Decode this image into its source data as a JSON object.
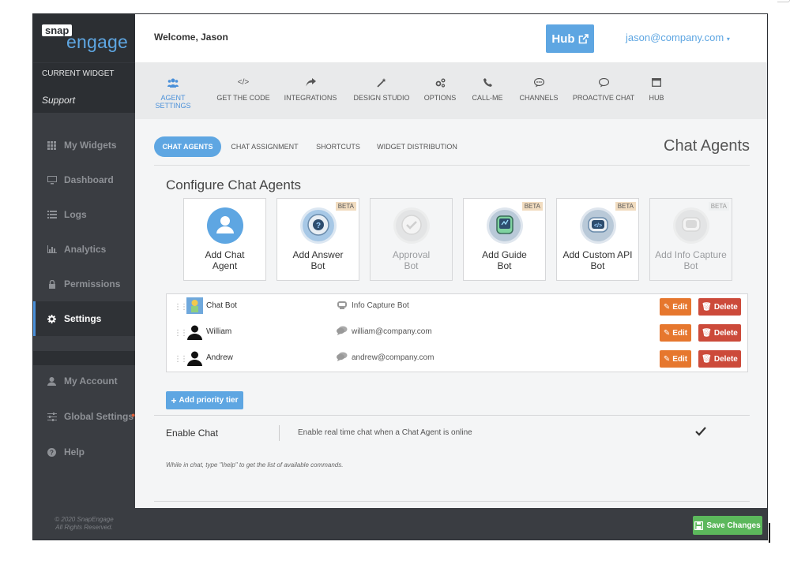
{
  "logo": {
    "top": "snap",
    "bottom": "engage"
  },
  "current_widget": {
    "label": "CURRENT WIDGET",
    "value": "Support"
  },
  "sidebar": {
    "items": [
      {
        "label": "My Widgets",
        "icon": "grid-icon"
      },
      {
        "label": "Dashboard",
        "icon": "monitor-icon"
      },
      {
        "label": "Logs",
        "icon": "list-icon"
      },
      {
        "label": "Analytics",
        "icon": "bar-chart-icon"
      },
      {
        "label": "Permissions",
        "icon": "lock-icon"
      },
      {
        "label": "Settings",
        "icon": "gear-icon",
        "active": true
      },
      {
        "label": "My Account",
        "icon": "user-icon"
      },
      {
        "label": "Global Settings",
        "icon": "sliders-icon"
      },
      {
        "label": "Help",
        "icon": "help-icon"
      }
    ],
    "copyright_line1": "© 2020 SnapEngage",
    "copyright_line2": "All Rights Reserved."
  },
  "header": {
    "welcome": "Welcome, Jason",
    "hub_label": "Hub",
    "user_email": "jason@company.com"
  },
  "tabs": [
    {
      "label": "AGENT SETTINGS",
      "icon": "users-icon",
      "active": true
    },
    {
      "label": "GET THE CODE",
      "icon": "code-icon"
    },
    {
      "label": "INTEGRATIONS",
      "icon": "share-arrow-icon"
    },
    {
      "label": "DESIGN STUDIO",
      "icon": "magic-wand-icon"
    },
    {
      "label": "OPTIONS",
      "icon": "cogs-icon"
    },
    {
      "label": "CALL-ME",
      "icon": "phone-icon"
    },
    {
      "label": "CHANNELS",
      "icon": "chat-bubble-icon"
    },
    {
      "label": "PROACTIVE CHAT",
      "icon": "speech-bubble-icon"
    },
    {
      "label": "HUB",
      "icon": "window-icon"
    }
  ],
  "subtabs": [
    {
      "label": "CHAT AGENTS",
      "active": true
    },
    {
      "label": "CHAT ASSIGNMENT"
    },
    {
      "label": "SHORTCUTS"
    },
    {
      "label": "WIDGET DISTRIBUTION"
    }
  ],
  "page_title": "Chat Agents",
  "config_title": "Configure Chat Agents",
  "cards": [
    {
      "label1": "Add Chat",
      "label2": "Agent",
      "beta": "",
      "disabled": false
    },
    {
      "label1": "Add Answer",
      "label2": "Bot",
      "beta": "BETA",
      "disabled": false
    },
    {
      "label1": "Approval",
      "label2": "Bot",
      "beta": "",
      "disabled": true
    },
    {
      "label1": "Add Guide",
      "label2": "Bot",
      "beta": "BETA",
      "disabled": false
    },
    {
      "label1": "Add Custom API",
      "label2": "Bot",
      "beta": "BETA",
      "disabled": false
    },
    {
      "label1": "Add Info Capture",
      "label2": "Bot",
      "beta": "BETA",
      "disabled": true
    }
  ],
  "agents": [
    {
      "name": "Chat Bot",
      "detail": "Info Capture Bot",
      "edit": "Edit",
      "delete": "Delete"
    },
    {
      "name": "William",
      "detail": "william@company.com",
      "edit": "Edit",
      "delete": "Delete"
    },
    {
      "name": "Andrew",
      "detail": "andrew@company.com",
      "edit": "Edit",
      "delete": "Delete"
    }
  ],
  "add_priority_tier": "Add priority tier",
  "enable_chat": {
    "label": "Enable Chat",
    "description": "Enable real time chat when a Chat Agent is online",
    "checked": true
  },
  "help_note": "While in chat, type \"\\help\" to get the list of available commands.",
  "footer": {
    "save_label": "Save Changes"
  },
  "colors": {
    "accent": "#5ea6e2",
    "edit": "#e6772e",
    "delete": "#cc4a3a",
    "save": "#5cb85c",
    "sidebar": "#3a3d42"
  }
}
